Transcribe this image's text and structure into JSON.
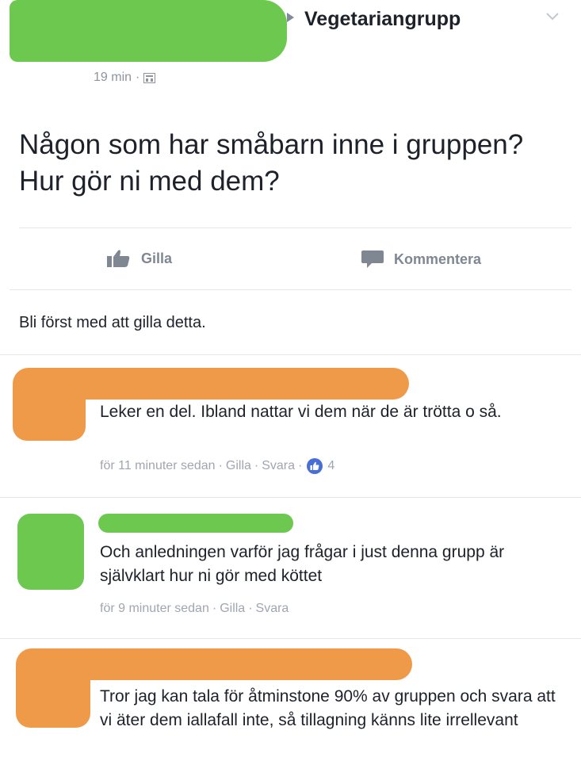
{
  "post": {
    "group_name": "Vegetariangrupp",
    "time": "19 min",
    "separator": "·",
    "privacy_icon": "group-privacy-icon",
    "text": "Någon som har småbarn inne i gruppen? Hur gör ni med dem?"
  },
  "actions": {
    "like_label": "Gilla",
    "comment_label": "Kommentera"
  },
  "likes_summary": "Bli först med att gilla detta.",
  "comments": [
    {
      "text": "Leker en del. Ibland nattar vi dem när de är trötta o så.",
      "time": "för 11 minuter sedan",
      "like_label": "Gilla",
      "reply_label": "Svara",
      "reaction_count": "4"
    },
    {
      "text": "Och anledningen varför jag frågar i just denna grupp är självklart hur ni gör med köttet",
      "time": "för 9 minuter sedan",
      "like_label": "Gilla",
      "reply_label": "Svara"
    },
    {
      "text": "Tror jag kan tala för åtminstone 90% av gruppen och svara att vi äter dem iallafall inte, så tillagning känns lite irrellevant"
    }
  ],
  "colors": {
    "redaction_green": "#6dc84f",
    "redaction_orange": "#ef9a48",
    "like_badge": "#4a6fd4",
    "meta_gray": "#a0a6b0"
  }
}
